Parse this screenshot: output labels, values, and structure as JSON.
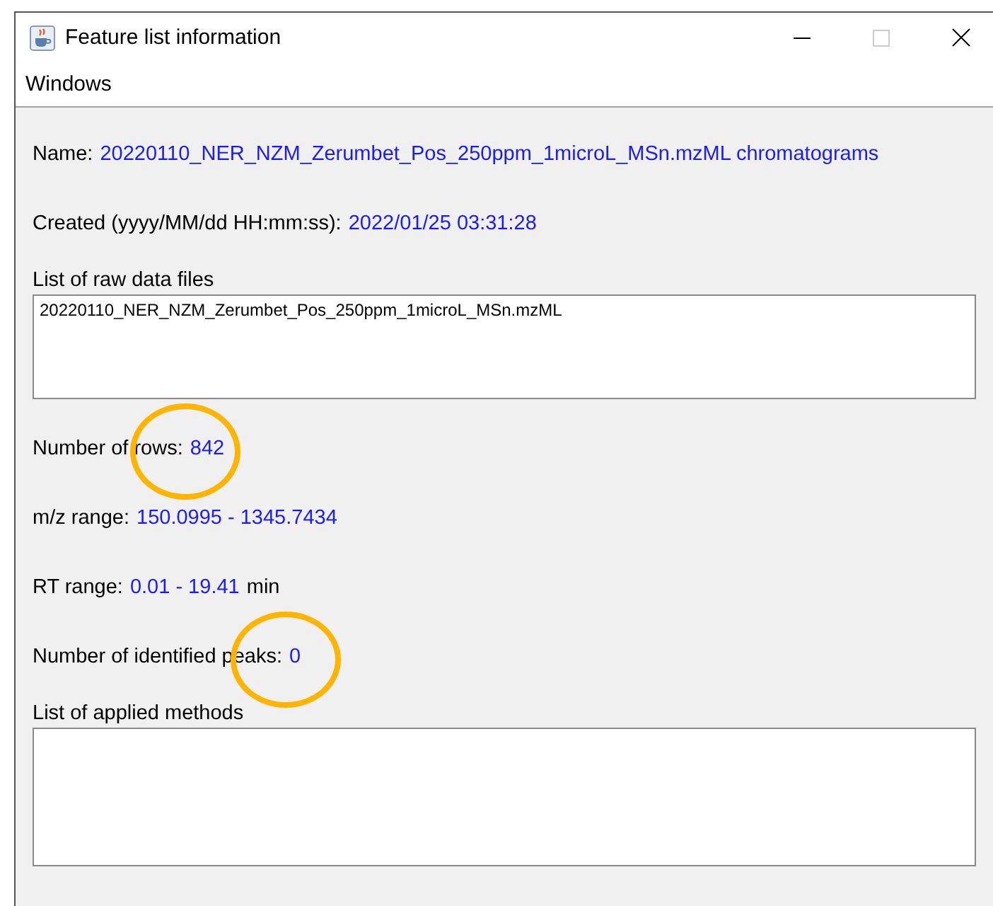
{
  "window": {
    "title": "Feature list information"
  },
  "menu": [
    "Windows"
  ],
  "sections": [
    {
      "kind": "field",
      "label": "Name:",
      "value": "20220110_NER_NZM_Zerumbet_Pos_250ppm_1microL_MSn.mzML chromatograms",
      "circled": false
    },
    {
      "kind": "field",
      "label": "Created (yyyy/MM/dd HH:mm:ss):",
      "value": "2022/01/25 03:31:28",
      "circled": false
    },
    {
      "kind": "list",
      "label": "List of raw data files",
      "items": [
        "20220110_NER_NZM_Zerumbet_Pos_250ppm_1microL_MSn.mzML"
      ]
    },
    {
      "kind": "field",
      "label": "Number of rows:",
      "value": "842",
      "circled": true
    },
    {
      "kind": "field",
      "label": "m/z range:",
      "value": "150.0995 - 1345.7434",
      "circled": false
    },
    {
      "kind": "field",
      "label": "RT range:",
      "value": "0.01 - 19.41",
      "unit": "min",
      "circled": false
    },
    {
      "kind": "field",
      "label": "Number of identified peaks:",
      "value": "0",
      "circled": true
    },
    {
      "kind": "list",
      "label": "List of applied methods"
    }
  ]
}
